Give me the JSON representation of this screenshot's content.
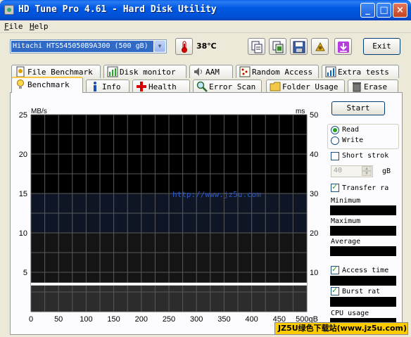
{
  "window": {
    "title": "HD Tune Pro 4.61 - Hard Disk Utility",
    "minimize_glyph": "_",
    "maximize_glyph": "□",
    "close_glyph": "×"
  },
  "menu": {
    "items": [
      {
        "hotkey": "F",
        "rest": "ile"
      },
      {
        "hotkey": "H",
        "rest": "elp"
      }
    ]
  },
  "toolbar": {
    "drive": "Hitachi HTS545050B9A300 (500 gB)",
    "temperature": "38℃",
    "exit_label": "Exit",
    "icons": [
      "copy-text-icon",
      "copy-screenshot-icon",
      "save-icon",
      "options-icon",
      "download-icon"
    ]
  },
  "tabs": {
    "row1": [
      "File Benchmark",
      "Disk monitor",
      "AAM",
      "Random Access",
      "Extra tests"
    ],
    "row2": [
      "Benchmark",
      "Info",
      "Health",
      "Error Scan",
      "Folder Usage",
      "Erase"
    ],
    "active": "Benchmark"
  },
  "chart": {
    "left_unit": "MB/s",
    "right_unit": "ms",
    "watermark": "http://www.jz5u.com",
    "x_unit": "500gB"
  },
  "chart_data": {
    "type": "line",
    "title": "",
    "xlabel": "",
    "ylabel": "MB/s",
    "y2label": "ms",
    "xlim": [
      0,
      500
    ],
    "ylim": [
      0,
      25
    ],
    "y2lim": [
      0,
      50
    ],
    "x_ticks": [
      "0",
      "50",
      "100",
      "150",
      "200",
      "250",
      "300",
      "350",
      "400",
      "450",
      "500gB"
    ],
    "y_ticks": [
      "5",
      "10",
      "15",
      "20",
      "25"
    ],
    "y2_ticks": [
      "10",
      "20",
      "30",
      "40",
      "50"
    ],
    "grid": true,
    "series": [
      {
        "x": [
          0,
          500
        ],
        "y": [
          3.5,
          3.5
        ],
        "color": "#ffffff"
      }
    ]
  },
  "panel": {
    "start_label": "Start",
    "read_label": "Read",
    "write_label": "Write",
    "short_stroke_label": "Short strok",
    "short_stroke_value": "40",
    "short_stroke_unit": "gB",
    "transfer_rate_label": "Transfer ra",
    "minimum_label": "Minimum",
    "maximum_label": "Maximum",
    "average_label": "Average",
    "access_time_label": "Access time",
    "burst_rate_label": "Burst rat",
    "cpu_usage_label": "CPU usage"
  },
  "footer_watermark": "JZ5U绿色下载站(www.jz5u.com)",
  "colors": {
    "title_bar": "#0054e3",
    "selection": "#316ac5",
    "chart_bg": "#000000",
    "check_mark": "#21a121"
  }
}
